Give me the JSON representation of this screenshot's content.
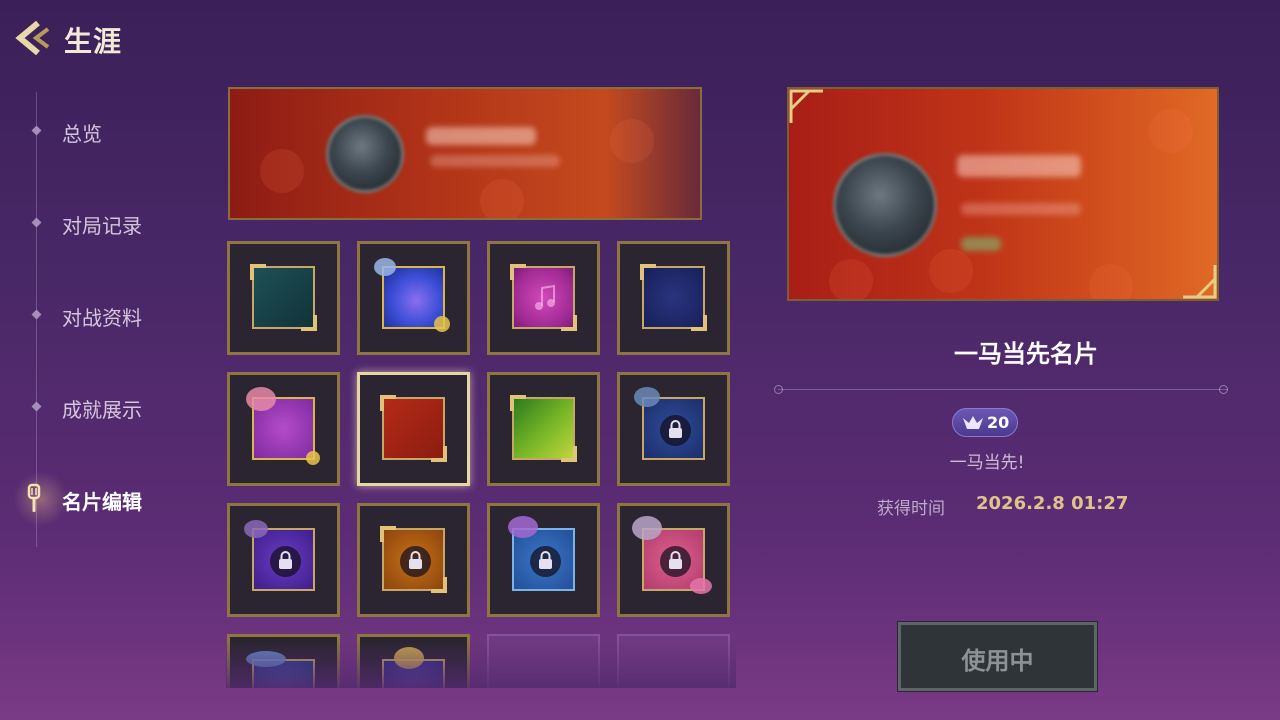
{
  "header": {
    "title": "生涯",
    "back_icon": "back-chevron-icon"
  },
  "sidebar": {
    "items": [
      {
        "label": "总览",
        "active": false
      },
      {
        "label": "对局记录",
        "active": false
      },
      {
        "label": "对战资料",
        "active": false
      },
      {
        "label": "成就展示",
        "active": false
      },
      {
        "label": "名片编辑",
        "active": true,
        "icon": "spatula-icon"
      }
    ]
  },
  "grid": {
    "tiles": [
      {
        "theme": "teal",
        "locked": false
      },
      {
        "theme": "galaxy",
        "locked": false
      },
      {
        "theme": "music-pink",
        "locked": false
      },
      {
        "theme": "navy",
        "locked": false
      },
      {
        "theme": "purple-bell",
        "locked": false
      },
      {
        "theme": "red-horse",
        "locked": false,
        "selected": true
      },
      {
        "theme": "green",
        "locked": false
      },
      {
        "theme": "blue-dragon",
        "locked": true
      },
      {
        "theme": "violet-star",
        "locked": true
      },
      {
        "theme": "amber",
        "locked": true
      },
      {
        "theme": "blue-spirit",
        "locked": true
      },
      {
        "theme": "pink-fox",
        "locked": true
      },
      {
        "theme": "blue-cloud",
        "locked": true
      },
      {
        "theme": "gold-crown",
        "locked": true
      },
      {
        "theme": "empty",
        "locked": false
      },
      {
        "theme": "empty",
        "locked": false
      }
    ]
  },
  "detail": {
    "card_name": "一马当先名片",
    "badge_value": "20",
    "source": "一马当先!",
    "time_label": "获得时间",
    "time_value": "2026.2.8  01:27",
    "use_button": "使用中"
  },
  "colors": {
    "gold_frame": "#8f7540",
    "card_red": "#b23418",
    "badge_purple": "#5c48a4",
    "time_gold": "#e2c28c"
  }
}
